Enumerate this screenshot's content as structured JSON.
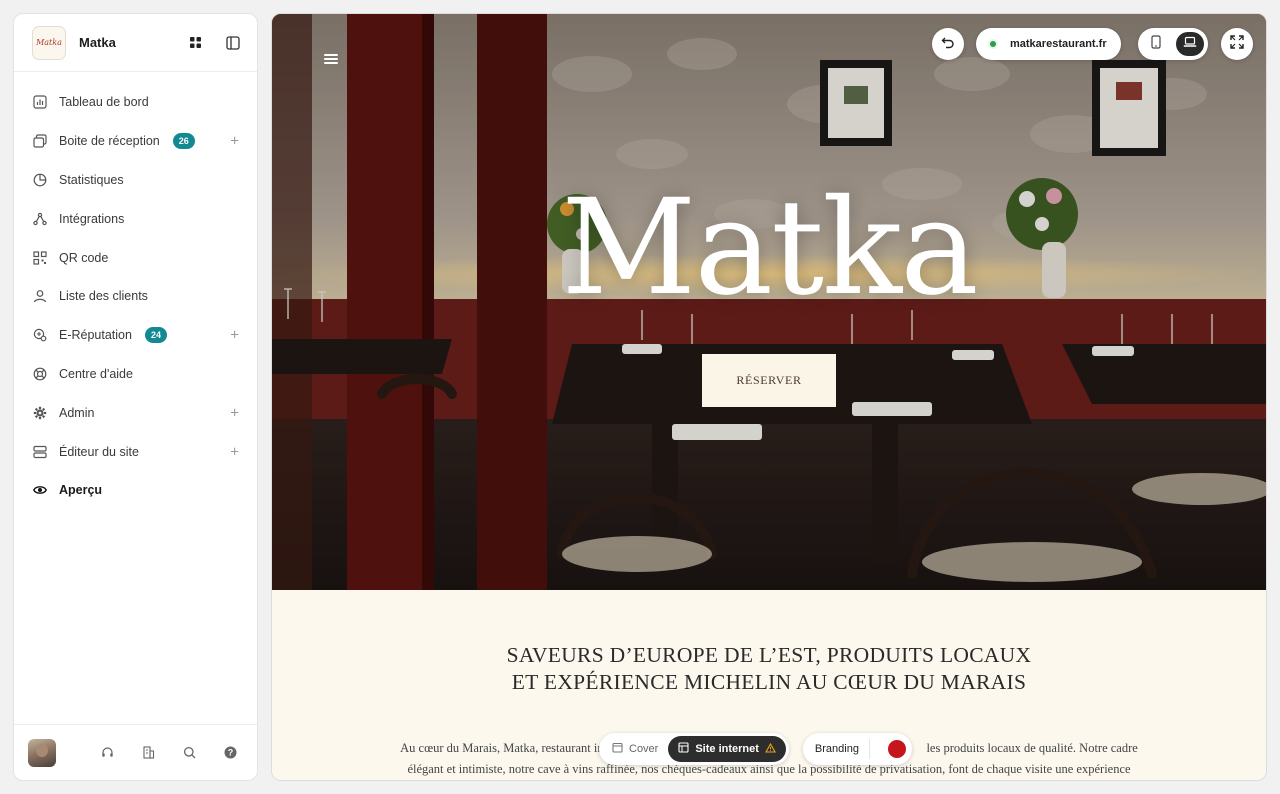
{
  "app": {
    "name": "Matka",
    "logo_text": "Matka"
  },
  "sidebar": {
    "items": [
      {
        "label": "Tableau de bord",
        "icon": "chart-bar-icon"
      },
      {
        "label": "Boite de réception",
        "icon": "inbox-icon",
        "badge": "26",
        "expandable": true
      },
      {
        "label": "Statistiques",
        "icon": "pie-chart-icon"
      },
      {
        "label": "Intégrations",
        "icon": "share-nodes-icon"
      },
      {
        "label": "QR code",
        "icon": "qr-code-icon"
      },
      {
        "label": "Liste des clients",
        "icon": "users-icon"
      },
      {
        "label": "E-Réputation",
        "icon": "reputation-icon",
        "badge": "24",
        "expandable": true
      },
      {
        "label": "Centre d'aide",
        "icon": "lifebuoy-icon"
      },
      {
        "label": "Admin",
        "icon": "gear-icon",
        "expandable": true
      },
      {
        "label": "Éditeur du site",
        "icon": "server-icon",
        "expandable": true
      },
      {
        "label": "Aperçu",
        "icon": "eye-icon",
        "active": true
      }
    ],
    "plus_symbol": "+"
  },
  "preview": {
    "url": "matkarestaurant.fr",
    "hero_title": "Matka",
    "reserve_label": "RÉSERVER",
    "tagline_line1": "SAVEURS D’EUROPE DE L’EST, PRODUITS LOCAUX",
    "tagline_line2": "ET EXPÉRIENCE MICHELIN AU CŒUR DU MARAIS",
    "paragraph_line1": "Au cœur du Marais, Matka, restaurant ins",
    "paragraph_line1_end": "les produits locaux de qualité. Notre cadre",
    "paragraph_line2": "élégant et intimiste, notre cave à vins raffinée, nos chèques-cadeaux ainsi que la possibilité de privatisation, font de chaque visite une expérience"
  },
  "bottom_bar": {
    "tabs": [
      {
        "label": "Cover",
        "active": false
      },
      {
        "label": "Site internet",
        "active": true,
        "warning": true
      }
    ],
    "branding_label": "Branding",
    "brand_color": "#c4161c"
  },
  "colors": {
    "accent_badge": "#128a93",
    "cream": "#fcf8ee"
  }
}
